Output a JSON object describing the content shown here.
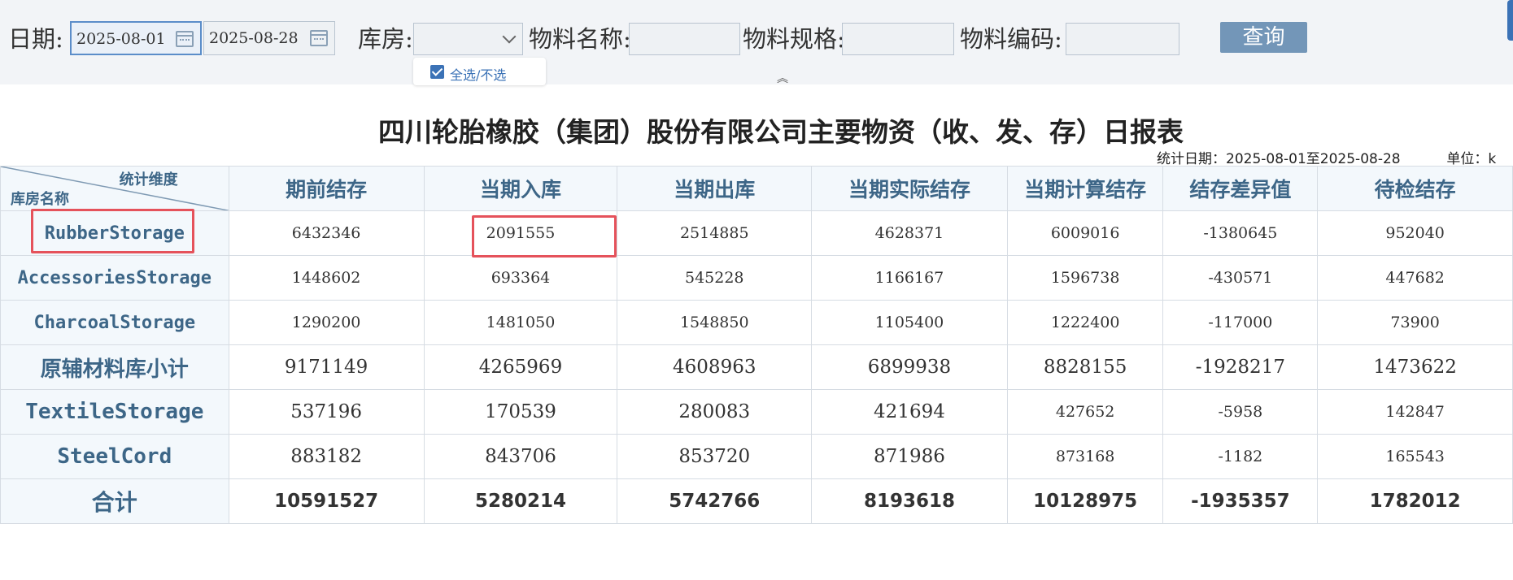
{
  "filters": {
    "date_label": "日期:",
    "date_start": "2025-08-01",
    "date_end": "2025-08-28",
    "warehouse_label": "库房:",
    "warehouse_value": "",
    "material_name_label": "物料名称:",
    "material_name_value": "",
    "material_spec_label": "物料规格:",
    "material_spec_value": "",
    "material_code_label": "物料编码:",
    "material_code_value": "",
    "query_label": "查询",
    "select_all_label": "全选/不选"
  },
  "report": {
    "title": "四川轮胎橡胶（集团）股份有限公司主要物资（收、发、存）日报表",
    "stat_date_text": "统计日期：2025-08-01至2025-08-28",
    "unit_text": "单位：k",
    "corner_top": "统计维度",
    "corner_bottom": "库房名称",
    "columns": [
      "期前结存",
      "当期入库",
      "当期出库",
      "当期实际结存",
      "当期计算结存",
      "结存差异值",
      "待检结存"
    ],
    "rows": [
      {
        "name": "RubberStorage",
        "values": [
          "6432346",
          "2091555",
          "2514885",
          "4628371",
          "6009016",
          "-1380645",
          "952040"
        ]
      },
      {
        "name": "AccessoriesStorage",
        "values": [
          "1448602",
          "693364",
          "545228",
          "1166167",
          "1596738",
          "-430571",
          "447682"
        ]
      },
      {
        "name": "CharcoalStorage",
        "values": [
          "1290200",
          "1481050",
          "1548850",
          "1105400",
          "1222400",
          "-117000",
          "73900"
        ]
      },
      {
        "name": "原辅材料库小计",
        "values": [
          "9171149",
          "4265969",
          "4608963",
          "6899938",
          "8828155",
          "-1928217",
          "1473622"
        ]
      },
      {
        "name": "TextileStorage",
        "values": [
          "537196",
          "170539",
          "280083",
          "421694",
          "427652",
          "-5958",
          "142847"
        ]
      },
      {
        "name": "SteelCord",
        "values": [
          "883182",
          "843706",
          "853720",
          "871986",
          "873168",
          "-1182",
          "165543"
        ]
      },
      {
        "name": "合计",
        "values": [
          "10591527",
          "5280214",
          "5742766",
          "8193618",
          "10128975",
          "-1935357",
          "1782012"
        ]
      }
    ]
  },
  "colors": {
    "header_text": "#3d6687",
    "header_bg": "#f3f8fc",
    "query_button": "#7396b8",
    "highlight_box": "#e5525b",
    "checkbox": "#3b72b6"
  }
}
